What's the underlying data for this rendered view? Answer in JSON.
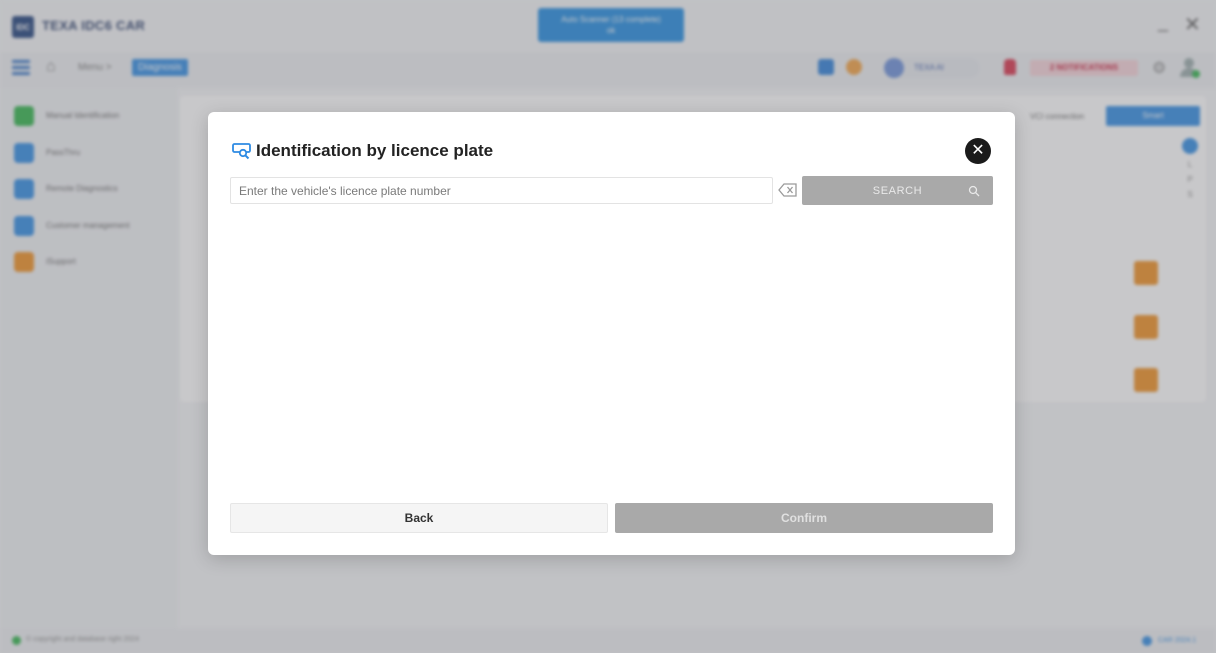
{
  "app": {
    "title": "TEXA IDC6 CAR",
    "logo_text": "IDC",
    "toast_line1": "Auto Scanner (13 complete)",
    "toast_line2": "ok"
  },
  "toolbar": {
    "breadcrumb_menu": "Menu >",
    "breadcrumb_active": "Diagnosis",
    "ai_label": "TEXA AI",
    "notifications": "2 NOTIFICATIONS",
    "accent_color": "#2e8be3"
  },
  "sidebar": {
    "items": [
      {
        "label": "Manual Identification",
        "color": "#2fb34a"
      },
      {
        "label": "PassThru",
        "color": "#2e8be3"
      },
      {
        "label": "Remote Diagnostics",
        "color": "#2e8be3"
      },
      {
        "label": "Customer management",
        "color": "#2e8be3"
      },
      {
        "label": "iSupport",
        "color": "#ef8f20"
      }
    ]
  },
  "content": {
    "vci_label": "VCI connection",
    "smart_label": "Smart",
    "right_col": [
      "L",
      "P",
      "S"
    ]
  },
  "status": {
    "left_text": "© copyright and database right 2024",
    "right_text": "CAR 2024.1"
  },
  "modal": {
    "title": "Identification by licence plate",
    "input_placeholder": "Enter the vehicle's licence plate number",
    "input_value": "",
    "search_label": "SEARCH",
    "back_label": "Back",
    "confirm_label": "Confirm",
    "icon_name": "license-plate-search-icon",
    "disabled_color": "#a9a9a9"
  }
}
